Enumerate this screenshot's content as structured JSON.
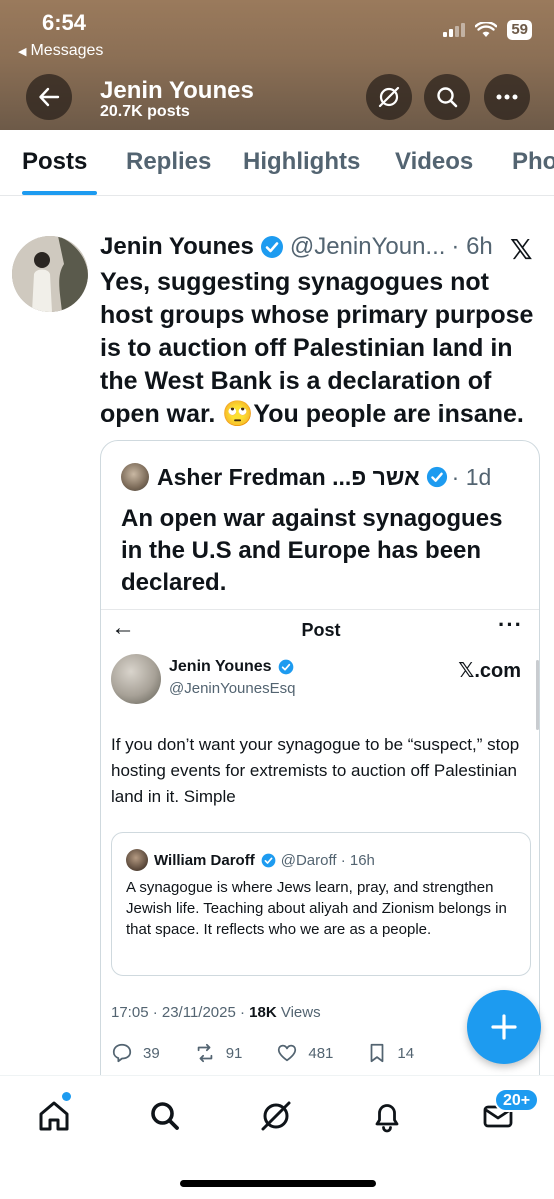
{
  "status_bar": {
    "time": "6:54",
    "back_app": "Messages",
    "battery": "59"
  },
  "header": {
    "profile_name": "Jenin Younes",
    "post_count": "20.7K posts",
    "icons": [
      "back-arrow-icon",
      "grok-icon",
      "search-icon",
      "more-icon"
    ]
  },
  "tabs": [
    "Posts",
    "Replies",
    "Highlights",
    "Videos",
    "Pho"
  ],
  "post": {
    "author_name": "Jenin Younes",
    "author_handle": "@JeninYoun...",
    "time": "· 6h",
    "text": "Yes, suggesting synagogues not host groups whose primary purpose is to auction off Palestinian land in the West Bank is a declaration of open war. 🙄You people are insane.",
    "quote": {
      "author_name": "Asher Fredman ...אשר פ",
      "time": "· 1d",
      "text": "An open war against synagogues in the U.S and Europe has been declared.",
      "screenshot": {
        "title": "Post",
        "author_name": "Jenin Younes",
        "author_handle": "@JeninYounesEsq",
        "watermark": "𝕏.com",
        "text": "If you don’t want your synagogue to be “suspect,” stop hosting events for extremists to auction off Palestinian land in it. Simple",
        "inner_quote": {
          "author_name": "William Daroff",
          "meta": "@Daroff · 16h",
          "text": "A synagogue is where Jews learn, pray, and strengthen Jewish life. Teaching about aliyah and Zionism belongs in that space. It reflects who we are as a people."
        },
        "timestamp": "17:05 · 23/11/2025 · ",
        "views_count": "18K",
        "views_label": " Views",
        "replies": "39",
        "reposts": "91",
        "likes": "481",
        "bookmarks": "14"
      }
    }
  },
  "fab": {
    "label": "+"
  },
  "bottom_nav": {
    "items": [
      "home-icon",
      "search-icon",
      "grok-icon",
      "notifications-icon",
      "messages-icon"
    ],
    "messages_badge": "20+"
  },
  "colors": {
    "accent": "#1d9bf0",
    "text": "#0f1419",
    "secondary": "#536471",
    "header_bg": "#8b6f55"
  }
}
